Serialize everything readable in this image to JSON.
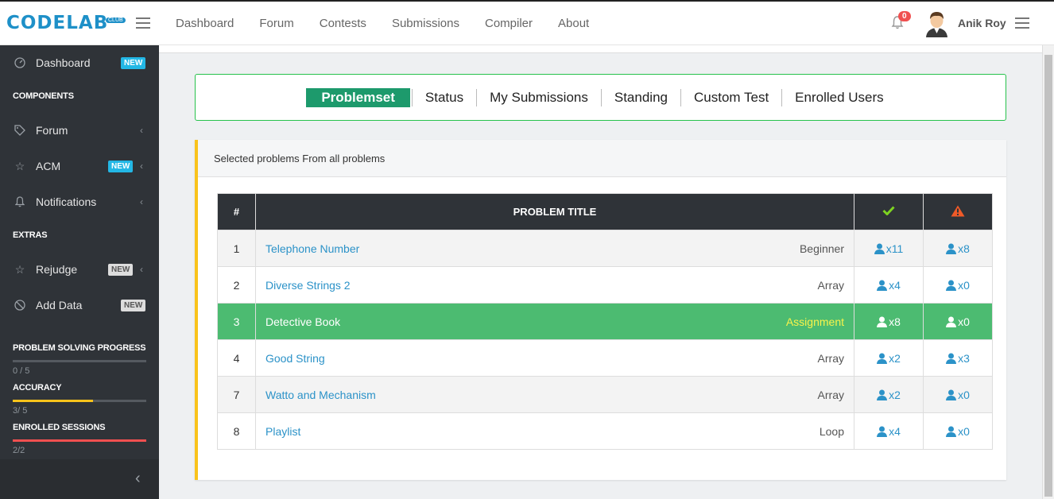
{
  "header": {
    "logo_text": "CODELAB",
    "logo_sub": "CLUB",
    "nav": [
      "Dashboard",
      "Forum",
      "Contests",
      "Submissions",
      "Compiler",
      "About"
    ],
    "notification_count": "0",
    "user_name": "Anik Roy"
  },
  "sidebar": {
    "dashboard": {
      "label": "Dashboard",
      "badge": "NEW"
    },
    "components_title": "COMPONENTS",
    "forum": {
      "label": "Forum"
    },
    "acm": {
      "label": "ACM",
      "badge": "NEW"
    },
    "notifications": {
      "label": "Notifications"
    },
    "extras_title": "EXTRAS",
    "rejudge": {
      "label": "Rejudge",
      "badge": "NEW"
    },
    "add_data": {
      "label": "Add Data",
      "badge": "NEW"
    },
    "progress": [
      {
        "title": "PROBLEM SOLVING PROGRESS",
        "text": "0 / 5",
        "fraction": 0.0,
        "color": "#9aa0a6"
      },
      {
        "title": "ACCURACY",
        "text": "3/ 5",
        "fraction": 0.6,
        "color": "#f9c31b"
      },
      {
        "title": "ENROLLED SESSIONS",
        "text": "2/2",
        "fraction": 1.0,
        "color": "#f05050"
      }
    ]
  },
  "tabs": [
    "Problemset",
    "Status",
    "My Submissions",
    "Standing",
    "Custom Test",
    "Enrolled Users"
  ],
  "active_tab": "Problemset",
  "panel": {
    "heading": "Selected problems From all problems",
    "columns": {
      "num": "#",
      "title": "PROBLEM TITLE"
    },
    "icons": {
      "accepted": "check-icon",
      "attempted": "warning-icon"
    },
    "colors": {
      "accepted": "#7ed321",
      "attempted": "#f05a28",
      "link": "#2b92c8",
      "highlight": "#4cbb71"
    },
    "rows": [
      {
        "num": "1",
        "title": "Telephone Number",
        "tag": "Beginner",
        "solved": "x11",
        "attempted": "x8",
        "highlight": false
      },
      {
        "num": "2",
        "title": "Diverse Strings 2",
        "tag": "Array",
        "solved": "x4",
        "attempted": "x0",
        "highlight": false
      },
      {
        "num": "3",
        "title": "Detective Book",
        "tag": "Assignment",
        "solved": "x8",
        "attempted": "x0",
        "highlight": true
      },
      {
        "num": "4",
        "title": "Good String",
        "tag": "Array",
        "solved": "x2",
        "attempted": "x3",
        "highlight": false
      },
      {
        "num": "7",
        "title": "Watto and Mechanism",
        "tag": "Array",
        "solved": "x2",
        "attempted": "x0",
        "highlight": false
      },
      {
        "num": "8",
        "title": "Playlist",
        "tag": "Loop",
        "solved": "x4",
        "attempted": "x0",
        "highlight": false
      }
    ]
  }
}
